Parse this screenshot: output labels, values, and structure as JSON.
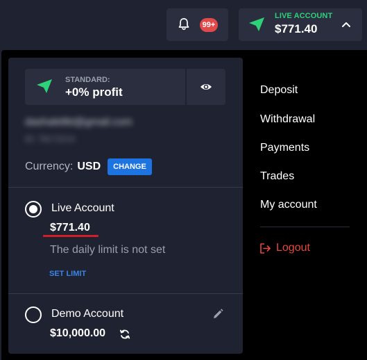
{
  "header": {
    "notifications_badge": "99+",
    "account_type": "LIVE ACCOUNT",
    "account_balance": "$771.40"
  },
  "profile": {
    "status_label": "STANDARD:",
    "status_value": "+0% profit",
    "email": "dashalelikt@gmail.com",
    "user_id": "ID: 78172214",
    "currency_label": "Currency:",
    "currency_value": "USD",
    "change_label": "CHANGE"
  },
  "accounts": {
    "live": {
      "name": "Live Account",
      "balance": "$771.40",
      "limit_text": "The daily limit is not set",
      "set_limit_label": "SET LIMIT",
      "selected": true
    },
    "demo": {
      "name": "Demo Account",
      "balance": "$10,000.00",
      "selected": false
    }
  },
  "menu": {
    "items": [
      "Deposit",
      "Withdrawal",
      "Payments",
      "Trades",
      "My account"
    ],
    "logout": "Logout"
  },
  "colors": {
    "accent_green": "#2fd07a",
    "accent_blue": "#1d74e0",
    "danger_red": "#e5483c",
    "badge_red": "#e14a4a"
  },
  "icons": [
    "bell-icon",
    "paper-plane-icon",
    "chevron-up-icon",
    "eye-icon",
    "pencil-icon",
    "refresh-icon",
    "logout-icon"
  ]
}
